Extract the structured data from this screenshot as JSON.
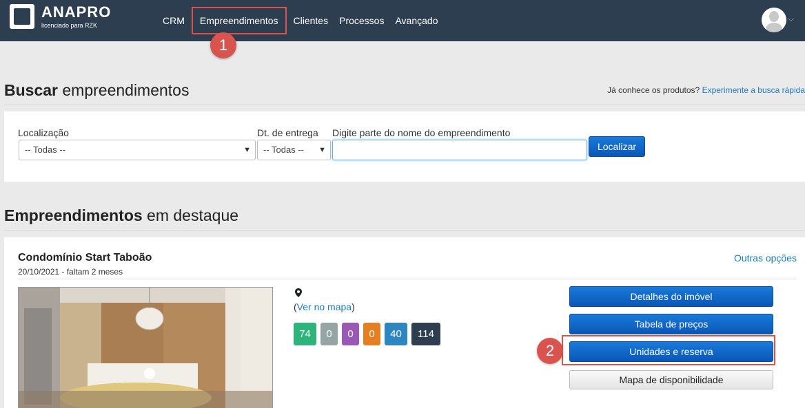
{
  "header": {
    "logo_name": "ANAPRO",
    "logo_sub": "licenciado para RZK",
    "nav": [
      "CRM",
      "Empreendimentos",
      "Clientes",
      "Processos",
      "Avançado"
    ],
    "active_nav": "Empreendimentos"
  },
  "markers": {
    "one": "1",
    "two": "2"
  },
  "buscar": {
    "title_bold": "Buscar",
    "title_rest": " empreendimentos",
    "hint_text": "Já conhece os produtos? ",
    "hint_link": "Experimente a busca rápida",
    "localizacao_label": "Localização",
    "localizacao_value": "-- Todas --",
    "entrega_label": "Dt. de entrega",
    "entrega_value": "-- Todas --",
    "nome_label": "Digite parte do nome do empreendimento",
    "nome_value": "",
    "submit": "Localizar"
  },
  "destaque": {
    "title_bold": "Empreendimentos",
    "title_rest": " em destaque",
    "card": {
      "name": "Condomínio Start Taboão",
      "date": "20/10/2021 - faltam 2 meses",
      "more_options": "Outras opções",
      "map_prefix": "(",
      "map_link": "Ver no mapa",
      "map_suffix": ")",
      "badges": [
        {
          "value": "74",
          "color": "#2eb37a"
        },
        {
          "value": "0",
          "color": "#95a5a6"
        },
        {
          "value": "0",
          "color": "#9b59b6"
        },
        {
          "value": "0",
          "color": "#e67e22"
        },
        {
          "value": "40",
          "color": "#2e86c1"
        },
        {
          "value": "114",
          "color": "#2c3e50"
        }
      ],
      "buttons": {
        "detalhes": "Detalhes do imóvel",
        "tabela": "Tabela de preços",
        "unidades": "Unidades e reserva",
        "mapa": "Mapa de disponibilidade"
      }
    }
  },
  "colors": {
    "topbar": "#2d3e50",
    "accent_blue": "#0a57b8",
    "highlight_red": "#d9534f",
    "link": "#1f7abf"
  }
}
